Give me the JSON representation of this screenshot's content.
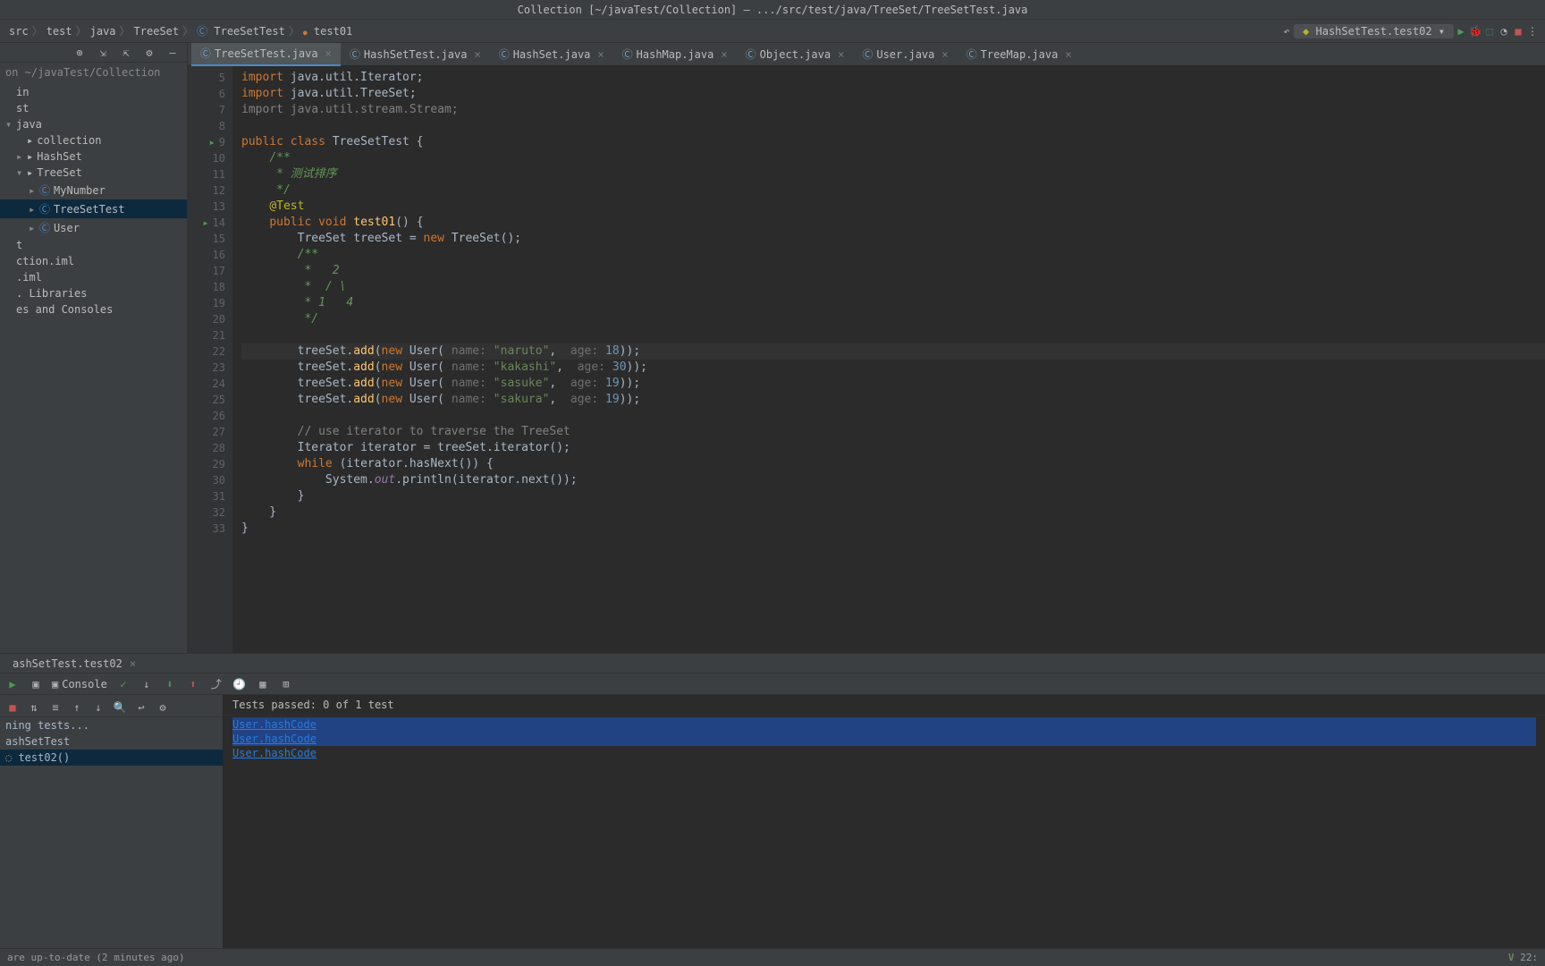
{
  "title": "Collection [~/javaTest/Collection] – .../src/test/java/TreeSet/TreeSetTest.java",
  "breadcrumb": [
    "src",
    "test",
    "java",
    "TreeSet",
    "TreeSetTest",
    "test01"
  ],
  "runConfig": "HashSetTest.test02",
  "sidebar": {
    "header": "on    ~/javaTest/Collection",
    "items": [
      {
        "label": "in",
        "indent": 0,
        "arrow": ""
      },
      {
        "label": "st",
        "indent": 0,
        "arrow": ""
      },
      {
        "label": "java",
        "indent": 0,
        "arrow": "▾"
      },
      {
        "label": "collection",
        "indent": 1,
        "arrow": "",
        "ico": "folder"
      },
      {
        "label": "HashSet",
        "indent": 1,
        "arrow": "▸",
        "ico": "folder"
      },
      {
        "label": "TreeSet",
        "indent": 1,
        "arrow": "▾",
        "ico": "folder"
      },
      {
        "label": "MyNumber",
        "indent": 2,
        "arrow": "▸",
        "ico": "c"
      },
      {
        "label": "TreeSetTest",
        "indent": 2,
        "arrow": "▸",
        "ico": "c",
        "selected": true
      },
      {
        "label": "User",
        "indent": 2,
        "arrow": "▸",
        "ico": "c"
      },
      {
        "label": "t",
        "indent": 0,
        "arrow": ""
      },
      {
        "label": "ction.iml",
        "indent": 0,
        "arrow": ""
      },
      {
        "label": ".iml",
        "indent": 0,
        "arrow": ""
      },
      {
        "label": ". Libraries",
        "indent": 0,
        "arrow": ""
      },
      {
        "label": "es and Consoles",
        "indent": 0,
        "arrow": ""
      }
    ]
  },
  "tabs": [
    {
      "label": "TreeSetTest.java",
      "active": true
    },
    {
      "label": "HashSetTest.java"
    },
    {
      "label": "HashSet.java"
    },
    {
      "label": "HashMap.java"
    },
    {
      "label": "Object.java"
    },
    {
      "label": "User.java"
    },
    {
      "label": "TreeMap.java"
    }
  ],
  "code": {
    "start": 5,
    "lines": [
      {
        "n": 5,
        "html": "<span class='kw'>import</span> java.util.Iterator;"
      },
      {
        "n": 6,
        "html": "<span class='kw'>import</span> java.util.TreeSet;"
      },
      {
        "n": 7,
        "html": "<span class='kw-weak'>import</span> <span class='kw-weak'>java.util.stream.Stream;</span>"
      },
      {
        "n": 8,
        "html": ""
      },
      {
        "n": 9,
        "html": "<span class='kw'>public</span> <span class='kw'>class</span> <span class='type'>TreeSetTest</span> {",
        "run": true
      },
      {
        "n": 10,
        "html": "    <span class='doc'>/**</span>"
      },
      {
        "n": 11,
        "html": "    <span class='doc'> * 测试排序</span>"
      },
      {
        "n": 12,
        "html": "    <span class='doc'> */</span>"
      },
      {
        "n": 13,
        "html": "    <span class='ann'>@Test</span>"
      },
      {
        "n": 14,
        "html": "    <span class='kw'>public</span> <span class='kw'>void</span> <span class='fn'>test01</span>() {",
        "run": true
      },
      {
        "n": 15,
        "html": "        <span class='type'>TreeSet</span> treeSet = <span class='kw'>new</span> <span class='type'>TreeSet</span>();"
      },
      {
        "n": 16,
        "html": "        <span class='doc'>/**</span>"
      },
      {
        "n": 17,
        "html": "        <span class='doc'> *   2</span>"
      },
      {
        "n": 18,
        "html": "        <span class='doc'> *  / \\</span>"
      },
      {
        "n": 19,
        "html": "        <span class='doc'> * 1   4</span>"
      },
      {
        "n": 20,
        "html": "        <span class='doc'> */</span>"
      },
      {
        "n": 21,
        "html": ""
      },
      {
        "n": 22,
        "html": "        treeSet.<span class='fn'>add</span>(<span class='kw'>new</span> User( <span class='hint'>name:</span> <span class='str'>\"naruto\"</span>,  <span class='hint'>age:</span> <span class='num'>18</span>));",
        "current": true
      },
      {
        "n": 23,
        "html": "        treeSet.<span class='fn'>add</span>(<span class='kw'>new</span> User( <span class='hint'>name:</span> <span class='str'>\"kakashi\"</span>,  <span class='hint'>age:</span> <span class='num'>30</span>));"
      },
      {
        "n": 24,
        "html": "        treeSet.<span class='fn'>add</span>(<span class='kw'>new</span> User( <span class='hint'>name:</span> <span class='str'>\"sasuke\"</span>,  <span class='hint'>age:</span> <span class='num'>19</span>));"
      },
      {
        "n": 25,
        "html": "        treeSet.<span class='fn'>add</span>(<span class='kw'>new</span> User( <span class='hint'>name:</span> <span class='str'>\"sakura\"</span>,  <span class='hint'>age:</span> <span class='num'>19</span>));"
      },
      {
        "n": 26,
        "html": ""
      },
      {
        "n": 27,
        "html": "        <span class='comment'>// use iterator to traverse the TreeSet</span>"
      },
      {
        "n": 28,
        "html": "        <span class='type'>Iterator</span> iterator = treeSet.iterator();"
      },
      {
        "n": 29,
        "html": "        <span class='kw'>while</span> (iterator.hasNext()) {"
      },
      {
        "n": 30,
        "html": "            System.<span class='field'>out</span>.println(iterator.next());"
      },
      {
        "n": 31,
        "html": "        }"
      },
      {
        "n": 32,
        "html": "    }"
      },
      {
        "n": 33,
        "html": "}"
      }
    ]
  },
  "runPanel": {
    "tab": "ashSetTest.test02",
    "consoleLabel": "Console",
    "status": "Tests passed: 0 of 1 test",
    "treeTop": "ning tests...",
    "treeClass": "ashSetTest",
    "treeMethod": "test02()",
    "out": [
      "User.hashCode",
      "User.hashCode",
      "User.hashCode"
    ]
  },
  "statusBar": {
    "left": "are up-to-date (2 minutes ago)",
    "time": "22:"
  }
}
